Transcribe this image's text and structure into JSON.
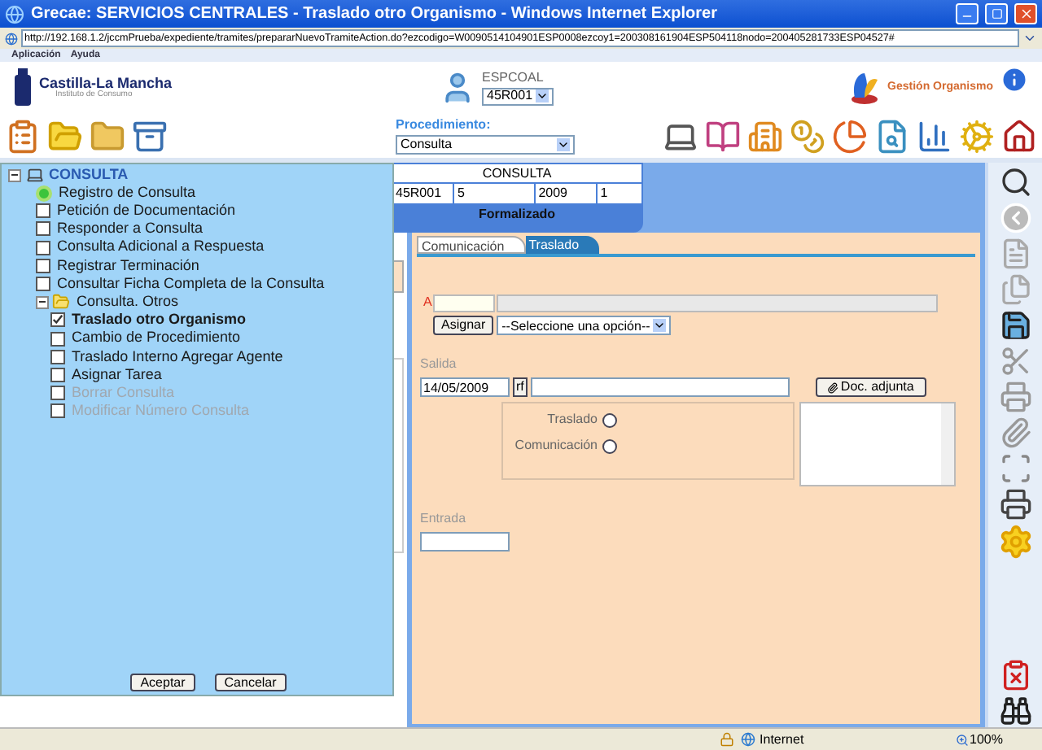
{
  "window": {
    "title": "Grecae: SERVICIOS CENTRALES - Traslado otro Organismo - Windows Internet Explorer"
  },
  "address_bar": {
    "url": "http://192.168.1.2/jccmPrueba/expediente/tramites/prepararNuevoTramiteAction.do?ezcodigo=W0090514104901ESP0008ezcoy1=200308161904ESP504118nodo=200405281733ESP04527#"
  },
  "menu_bar": [
    "Aplicación",
    "Ayuda"
  ],
  "header": {
    "logo_title": "Castilla-La Mancha",
    "logo_subtitle": "Instituto de Consumo",
    "user": "ESPCOAL",
    "office_select": "45R001",
    "organismo": "Gestión Organismo"
  },
  "toolbar": {
    "procedimiento_label": "Procedimiento:",
    "procedimiento_value": "Consulta"
  },
  "record": {
    "title": "CONSULTA",
    "fields": [
      "45R001",
      "5",
      "2009",
      "1"
    ],
    "status": "Formalizado"
  },
  "tabs": [
    {
      "label": "Comunicación",
      "selected": false
    },
    {
      "label": "Traslado",
      "selected": true
    }
  ],
  "form": {
    "a_label": "A",
    "assign_button": "Asignar",
    "select_value": "--Seleccione una opción--",
    "salida_label": "Salida",
    "salida_date": "14/05/2009",
    "rf_button": "rf",
    "doc_button": "Doc. adjunta",
    "radios": [
      {
        "label": "Traslado",
        "selected": false
      },
      {
        "label": "Comunicación",
        "selected": false
      }
    ],
    "entrada_label": "Entrada"
  },
  "tree": {
    "label": "CONSULTA",
    "expanded": true,
    "children": [
      {
        "kind": "status",
        "label": "Registro de Consulta",
        "disabled": false
      },
      {
        "kind": "task",
        "label": "Petición de Documentación",
        "checked": false,
        "disabled": false
      },
      {
        "kind": "task",
        "label": "Responder a Consulta",
        "checked": false,
        "disabled": false
      },
      {
        "kind": "task",
        "label": "Consulta Adicional a Respuesta",
        "checked": false,
        "disabled": false
      },
      {
        "kind": "task",
        "label": "Registrar Terminación",
        "checked": false,
        "disabled": false
      },
      {
        "kind": "task",
        "label": "Consultar Ficha Completa de la Consulta",
        "checked": false,
        "disabled": false
      },
      {
        "kind": "folder",
        "label": "Consulta. Otros",
        "expanded": true,
        "children": [
          {
            "kind": "task",
            "label": "Traslado otro Organismo",
            "checked": true,
            "disabled": false
          },
          {
            "kind": "task",
            "label": "Cambio de Procedimiento",
            "checked": false,
            "disabled": false
          },
          {
            "kind": "task",
            "label": "Traslado Interno Agregar Agente",
            "checked": false,
            "disabled": false
          },
          {
            "kind": "task",
            "label": "Asignar Tarea",
            "checked": false,
            "disabled": false
          },
          {
            "kind": "task",
            "label": "Borrar Consulta",
            "checked": false,
            "disabled": true
          },
          {
            "kind": "task",
            "label": "Modificar Número Consulta",
            "checked": false,
            "disabled": true
          }
        ]
      }
    ]
  },
  "dialog_buttons": [
    "Aceptar",
    "Cancelar"
  ],
  "status_bar": {
    "zone": "Internet",
    "zoom": "100%"
  }
}
